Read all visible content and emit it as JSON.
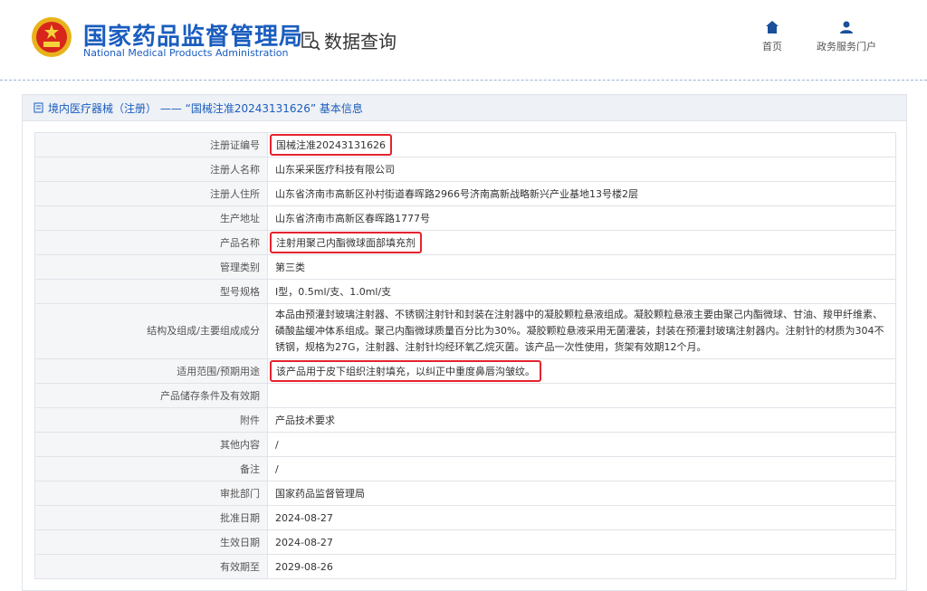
{
  "header": {
    "org_name_cn": "国家药品监督管理局",
    "org_name_en": "National Medical Products Administration",
    "section_title": "数据查询",
    "nav": [
      {
        "label": "首页",
        "icon": "home-icon"
      },
      {
        "label": "政务服务门户",
        "icon": "user-icon"
      }
    ]
  },
  "breadcrumb": {
    "text": "境内医疗器械（注册） —— “国械注准20243131626” 基本信息"
  },
  "colors": {
    "brand": "#1a5dbf",
    "highlight": "#e5232f"
  },
  "rows": [
    {
      "label": "注册证编号",
      "value": "国械注准20243131626",
      "highlight": true
    },
    {
      "label": "注册人名称",
      "value": "山东采采医疗科技有限公司"
    },
    {
      "label": "注册人住所",
      "value": "山东省济南市高新区孙村街道春晖路2966号济南高新战略新兴产业基地13号楼2层"
    },
    {
      "label": "生产地址",
      "value": "山东省济南市高新区春晖路1777号"
    },
    {
      "label": "产品名称",
      "value": "注射用聚己内酯微球面部填充剂",
      "highlight": true
    },
    {
      "label": "管理类别",
      "value": "第三类"
    },
    {
      "label": "型号规格",
      "value": "Ⅰ型，0.5ml/支、1.0ml/支"
    },
    {
      "label": "结构及组成/主要组成成分",
      "value": "本品由预灌封玻璃注射器、不锈钢注射针和封装在注射器中的凝胶颗粒悬液组成。凝胶颗粒悬液主要由聚己内酯微球、甘油、羧甲纤维素、磷酸盐缓冲体系组成。聚己内酯微球质量百分比为30%。凝胶颗粒悬液采用无菌灌装，封装在预灌封玻璃注射器内。注射针的材质为304不锈钢，规格为27G，注射器、注射针均经环氧乙烷灭菌。该产品一次性使用，货架有效期12个月。",
      "tall": true
    },
    {
      "label": "适用范围/预期用途",
      "value": "该产品用于皮下组织注射填充，以纠正中重度鼻唇沟皱纹。",
      "highlight": true
    },
    {
      "label": "产品储存条件及有效期",
      "value": ""
    },
    {
      "label": "附件",
      "value": "产品技术要求"
    },
    {
      "label": "其他内容",
      "value": "/"
    },
    {
      "label": "备注",
      "value": "/"
    },
    {
      "label": "审批部门",
      "value": "国家药品监督管理局"
    },
    {
      "label": "批准日期",
      "value": "2024-08-27"
    },
    {
      "label": "生效日期",
      "value": "2024-08-27"
    },
    {
      "label": "有效期至",
      "value": "2029-08-26"
    }
  ]
}
